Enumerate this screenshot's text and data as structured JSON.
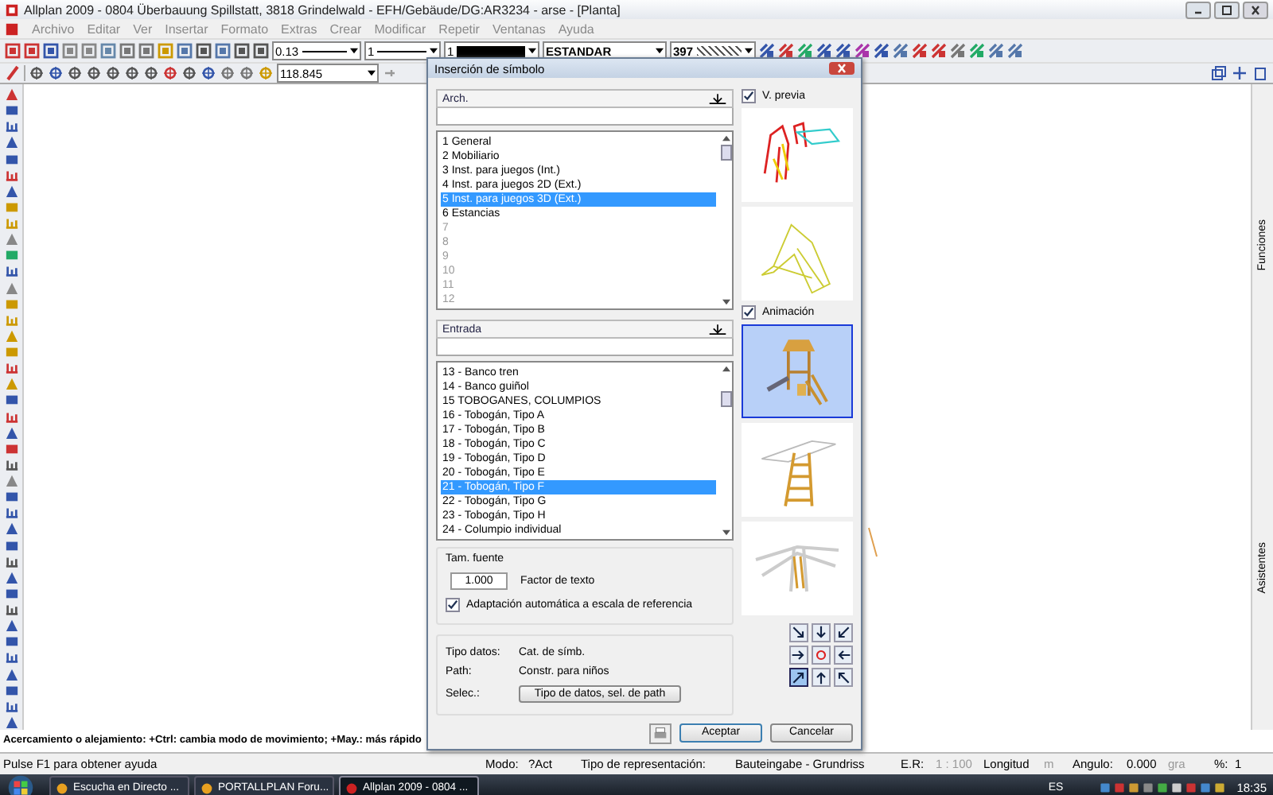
{
  "window": {
    "title": "Allplan 2009 - 0804 Überbauung Spillstatt, 3818 Grindelwald - EFH/Gebäude/DG:AR3234 - arse - [Planta]"
  },
  "menu": [
    {
      "label": "Archivo",
      "disabled": true
    },
    {
      "label": "Editar",
      "disabled": true
    },
    {
      "label": "Ver",
      "disabled": true
    },
    {
      "label": "Insertar",
      "disabled": true
    },
    {
      "label": "Formato",
      "disabled": true
    },
    {
      "label": "Extras",
      "disabled": true
    },
    {
      "label": "Crear",
      "disabled": true
    },
    {
      "label": "Modificar",
      "disabled": true
    },
    {
      "label": "Repetir",
      "disabled": true
    },
    {
      "label": "Ventanas",
      "disabled": true
    },
    {
      "label": "Ayuda",
      "disabled": true
    }
  ],
  "toolbar": {
    "pen": "0.13",
    "line": "1",
    "color_index": "1",
    "layer": "ESTANDAR",
    "hatch": "397"
  },
  "zoom_field": "118.845",
  "dialog": {
    "title": "Inserción de símbolo",
    "archive": {
      "header": "Arch.",
      "items": [
        {
          "label": "1 General",
          "selected": false,
          "disabled": false
        },
        {
          "label": "2 Mobiliario",
          "selected": false,
          "disabled": false
        },
        {
          "label": "3 Inst. para juegos (Int.)",
          "selected": false,
          "disabled": false
        },
        {
          "label": "4 Inst. para juegos 2D (Ext.)",
          "selected": false,
          "disabled": false
        },
        {
          "label": "5 Inst. para juegos 3D (Ext.)",
          "selected": true,
          "disabled": false
        },
        {
          "label": "6 Estancias",
          "selected": false,
          "disabled": false
        },
        {
          "label": "7",
          "selected": false,
          "disabled": true
        },
        {
          "label": "8",
          "selected": false,
          "disabled": true
        },
        {
          "label": "9",
          "selected": false,
          "disabled": true
        },
        {
          "label": "10",
          "selected": false,
          "disabled": true
        },
        {
          "label": "11",
          "selected": false,
          "disabled": true
        },
        {
          "label": "12",
          "selected": false,
          "disabled": true
        }
      ]
    },
    "entry": {
      "header": "Entrada",
      "items": [
        {
          "label": "13 - Banco tren",
          "selected": false
        },
        {
          "label": "14 - Banco guiñol",
          "selected": false
        },
        {
          "label": "15 TOBOGANES, COLUMPIOS",
          "selected": false
        },
        {
          "label": "16 - Tobogán, Tipo A",
          "selected": false
        },
        {
          "label": "17 - Tobogán, Tipo B",
          "selected": false
        },
        {
          "label": "18 - Tobogán, Tipo C",
          "selected": false
        },
        {
          "label": "19 - Tobogán, Tipo D",
          "selected": false
        },
        {
          "label": "20 - Tobogán, Tipo E",
          "selected": false
        },
        {
          "label": "21 - Tobogán, Tipo F",
          "selected": true
        },
        {
          "label": "22 - Tobogán, Tipo G",
          "selected": false
        },
        {
          "label": "23 - Tobogán, Tipo H",
          "selected": false
        },
        {
          "label": "24 - Columpio individual",
          "selected": false
        }
      ]
    },
    "preview_checkbox": {
      "label": "V. previa",
      "checked": true
    },
    "animation_checkbox": {
      "label": "Animación",
      "checked": true
    },
    "previews": [
      {
        "kind": "outline",
        "selected": false
      },
      {
        "kind": "frame",
        "selected": false
      },
      {
        "kind": "tower",
        "selected": true
      },
      {
        "kind": "ladder",
        "selected": false
      },
      {
        "kind": "slide",
        "selected": false
      }
    ],
    "font_size": {
      "title": "Tam. fuente",
      "value": "1.000",
      "label": "Factor de texto"
    },
    "auto_scale": {
      "label": "Adaptación automática a escala de referencia",
      "checked": true
    },
    "info": [
      {
        "label": "Tipo datos:",
        "value": "Cat. de símb."
      },
      {
        "label": "Path:",
        "value": "Constr. para niños"
      }
    ],
    "select": {
      "label": "Selec.:",
      "button": "Tipo de datos, sel. de path"
    },
    "anchors": [
      {
        "selected": false
      },
      {
        "selected": false
      },
      {
        "selected": false
      },
      {
        "selected": false
      },
      {
        "selected": false
      },
      {
        "selected": false
      },
      {
        "selected": true
      },
      {
        "selected": false
      },
      {
        "selected": false
      }
    ],
    "buttons": {
      "ok": "Aceptar",
      "cancel": "Cancelar"
    }
  },
  "side_tabs": [
    "Funciones",
    "Asistentes"
  ],
  "prompt": "Acercamiento o alejamiento: +Ctrl: cambia modo de movimiento; +May.: más rápido",
  "status_bar": {
    "help": "Pulse F1 para obtener ayuda",
    "mode": "Modo:",
    "mode_value": "?Act",
    "representation": "Tipo de representación:",
    "representation_value": "Bauteingabe - Grundriss",
    "scale_label": "E.R:",
    "scale": "1 : 100",
    "length_label": "Longitud",
    "length_unit": "m",
    "angle_label": "Angulo:",
    "angle": "0.000",
    "angle_unit": "gra",
    "percent_label": "%:",
    "percent": "1"
  },
  "taskbar": {
    "tasks": [
      {
        "label": "Escucha en Directo ...",
        "selected": false
      },
      {
        "label": "PORTALLPLAN Foru...",
        "selected": false
      },
      {
        "label": "Allplan 2009 - 0804 ...",
        "selected": true
      }
    ],
    "language": "ES",
    "clock": "18:35"
  }
}
